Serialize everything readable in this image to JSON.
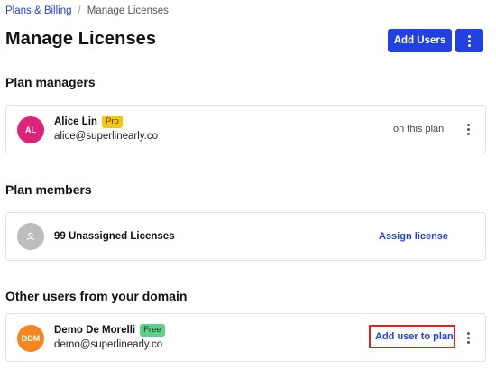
{
  "breadcrumb": {
    "parent": "Plans & Billing",
    "separator": "/",
    "current": "Manage Licenses"
  },
  "header": {
    "title": "Manage Licenses",
    "add_users_label": "Add Users",
    "more_icon": "vertical-dots-icon"
  },
  "sections": {
    "managers": {
      "title": "Plan managers",
      "user": {
        "initials": "AL",
        "name": "Alice Lin",
        "badge": "Pro",
        "email": "alice@superlinearly.co",
        "status": "on this plan",
        "avatar_color": "#e0237a",
        "badge_color": "#f5c518"
      }
    },
    "members": {
      "title": "Plan members",
      "unassigned": {
        "icon": "user-placeholder-icon",
        "label": "99 Unassigned Licenses",
        "action": "Assign license",
        "avatar_color": "#bdbdbd"
      }
    },
    "domain_users": {
      "title": "Other users from your domain",
      "user": {
        "initials": "DDM",
        "name": "Demo De Morelli",
        "badge": "Free",
        "email": "demo@superlinearly.co",
        "action": "Add user to plan",
        "avatar_color": "#f5861f",
        "badge_color": "#5fcf8a"
      }
    }
  },
  "colors": {
    "accent": "#2340e0",
    "highlight": "#e0231a"
  }
}
